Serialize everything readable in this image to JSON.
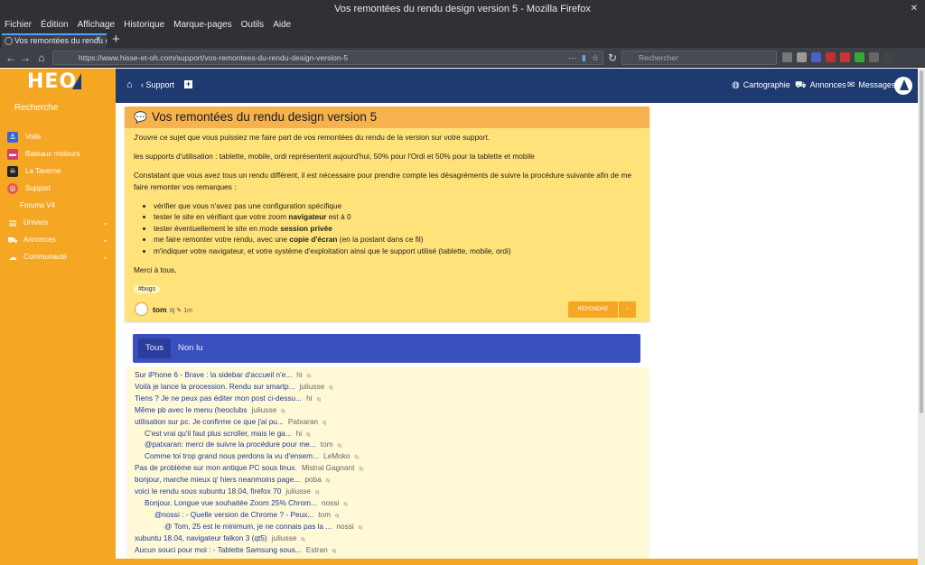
{
  "window": {
    "title": "Vos remontées du rendu design version 5 - Mozilla Firefox"
  },
  "menubar": [
    "Fichier",
    "Édition",
    "Affichage",
    "Historique",
    "Marque-pages",
    "Outils",
    "Aide"
  ],
  "tab": {
    "title": "Vos remontées du rendu d",
    "close": "×",
    "new": "+"
  },
  "urlbar": {
    "url": "https://www.hisse-et-oh.com/support/vos-remontees-du-rendu-design-version-5",
    "more": "···"
  },
  "search": {
    "placeholder": "Rechercher"
  },
  "sidebar": {
    "logo": "HEO",
    "search_label": "Recherche",
    "items": [
      {
        "label": "Voile",
        "color": "#3b64d6",
        "icon": "anchor-icon"
      },
      {
        "label": "Bateaux moteurs",
        "color": "#d83a6a",
        "icon": "motorboat-icon"
      },
      {
        "label": "La Taverne",
        "color": "#222222",
        "icon": "skull-icon"
      },
      {
        "label": "Support",
        "color": "#e05a4e",
        "icon": "lifebuoy-icon"
      },
      {
        "label": "Forums V4"
      },
      {
        "label": "Univers",
        "icon": "univers-icon"
      },
      {
        "label": "Annonces",
        "icon": "car-icon"
      },
      {
        "label": "Communauté",
        "icon": "chat-icon"
      }
    ]
  },
  "header": {
    "support": "Support",
    "cartographie": "Cartographie",
    "annonces": "Annonces",
    "messages": "Messages"
  },
  "post": {
    "title": "Vos remontées du rendu design version 5",
    "p1": "J'ouvre ce sujet que vous puissiez me faire part de vos remontées du rendu de la version sur votre support.",
    "p2": "les supports d'utilisation : tablette, mobile, ordi représentent aujourd'hui, 50% pour l'Ordi et 50% pour la tablette et mobile",
    "p3": "Constatant que vous avez tous un rendu différent, il est nécessaire pour prendre compte les désagréments de suivre la procédure suivante afin de me faire remonter vos remarques :",
    "list": {
      "l1": "vérifier que vous n'avez pas une configuration spécifique",
      "l2a": "tester le site en vérifiant que votre zoom ",
      "l2b": "navigateur",
      "l2c": " est à 0",
      "l3a": "tester éventuellement le site en mode ",
      "l3b": "session privée",
      "l4a": "me faire remonter votre rendu, avec une ",
      "l4b": "copie d'écran",
      "l4c": " (en la postant dans ce fil)",
      "l5": "m'indiquer votre navigateur, et votre système d'exploitation ainsi que le support utilisé (tablette, mobile, ordi)"
    },
    "p4": "Merci à tous,",
    "tag": "#bugs",
    "author": "tom",
    "age": "6j",
    "edit": "1m",
    "reply_button": "RÉPONDRE",
    "reply_more": "›"
  },
  "filters": {
    "all": "Tous",
    "unread": "Non lu"
  },
  "replies": [
    {
      "text": "Sur iPhone 6 - Brave : la sidebar d'accueil n'e...",
      "author": "hi",
      "time": "6j",
      "indent": 0
    },
    {
      "text": "Voilà je lance la procession. Rendu sur smartp...",
      "author": "juliusse",
      "time": "6j",
      "indent": 0
    },
    {
      "text": "Tiens ? Je ne peux pas éditer mon post ci-dessu...",
      "author": "hi",
      "time": "6j",
      "indent": 0
    },
    {
      "text": "Même pb avec le menu (heoclubs",
      "author": "juliusse",
      "time": "6j",
      "indent": 0
    },
    {
      "text": "utilisation sur pc. Je confirme ce que j'ai pu...",
      "author": "Patxaran",
      "time": "6j",
      "indent": 0
    },
    {
      "text": "C'est vrai qu'il faut plus scroller, mais le ga...",
      "author": "hi",
      "time": "6j",
      "indent": 1
    },
    {
      "text": "@patxaran: merci de suivre la procédure pour me...",
      "author": "tom",
      "time": "6j",
      "indent": 1
    },
    {
      "text": "Comme toi trop grand nous perdons la vu d'ensem...",
      "author": "LeMoko",
      "time": "6j",
      "indent": 1
    },
    {
      "text": "Pas de problème sur mon antique PC sous linux.",
      "author": "Mistral Gagnant",
      "time": "6j",
      "indent": 0
    },
    {
      "text": "bonjour, marche mieux q' hiers neanmoins page...",
      "author": "poba",
      "time": "6j",
      "indent": 0
    },
    {
      "text": "voici le rendu sous xubuntu 18.04, firefox 70",
      "author": "juliusse",
      "time": "6j",
      "indent": 0
    },
    {
      "text": "Bonjour. Longue vue souhaitée Zoom 25% Chrom...",
      "author": "nossi",
      "time": "6j",
      "indent": 1
    },
    {
      "text": "@nossi : - Quelle version de Chrome ? - Peux...",
      "author": "tom",
      "time": "6j",
      "indent": 2
    },
    {
      "text": "@ Tom, 25 est le minimum, je ne connais pas la ...",
      "author": "nossi",
      "time": "6j",
      "indent": 3
    },
    {
      "text": "xubuntu 18.04, navigateur falkon 3 (qt5)",
      "author": "juliusse",
      "time": "6j",
      "indent": 0
    },
    {
      "text": "Aucun souci pour moi : - Tablette Samsung sous...",
      "author": "Estran",
      "time": "6j",
      "indent": 0
    }
  ]
}
